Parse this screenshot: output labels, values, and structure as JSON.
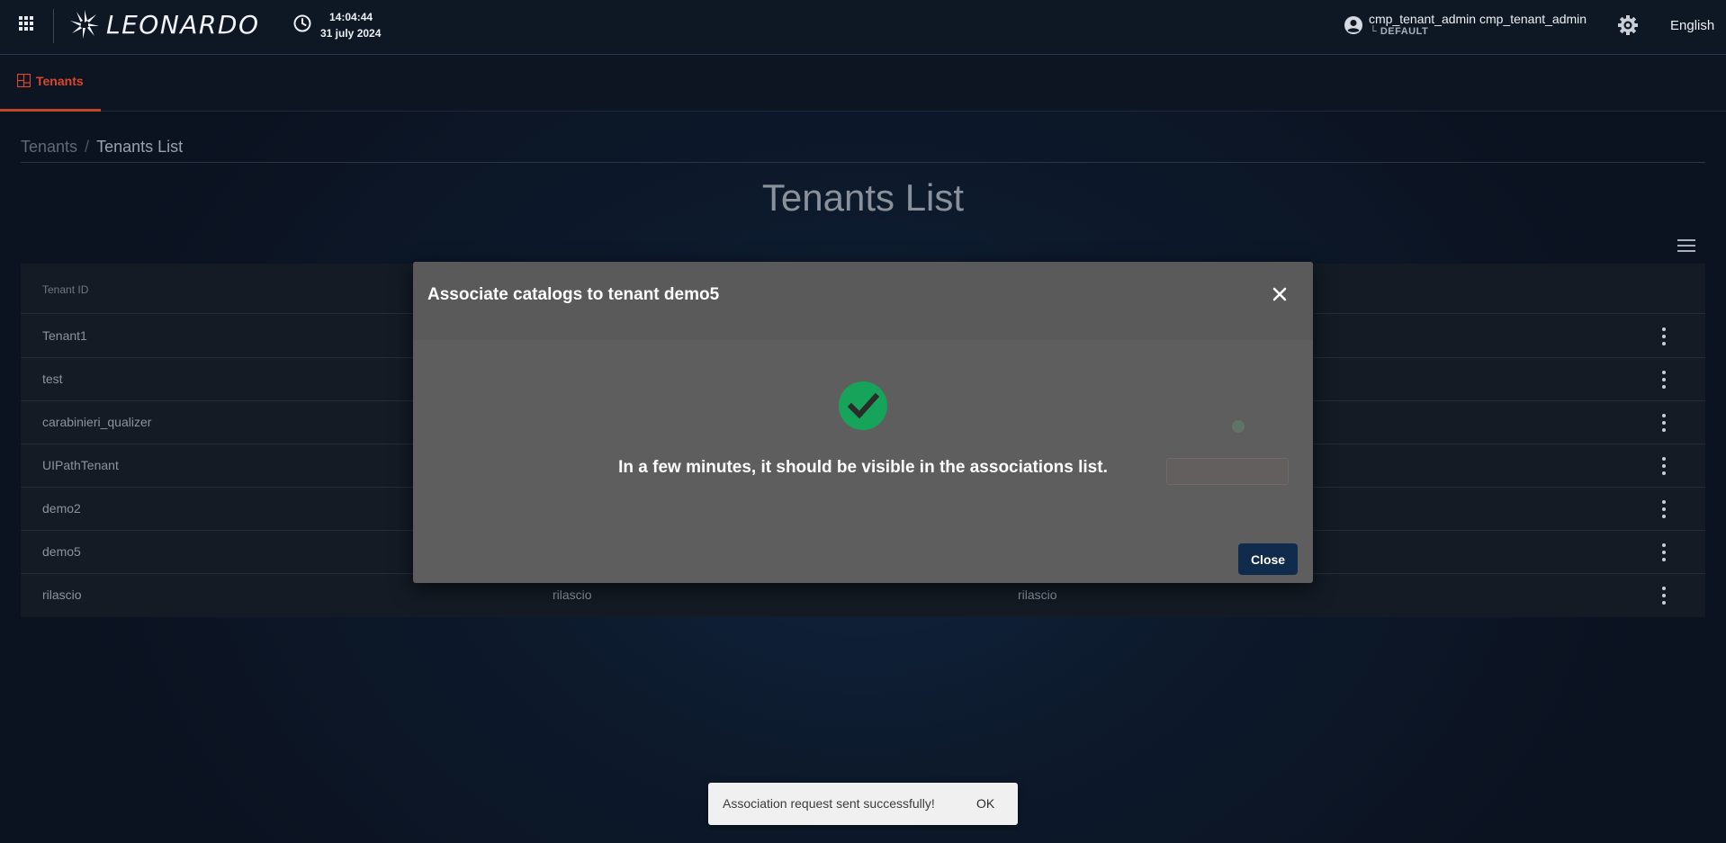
{
  "header": {
    "brand": "LEONARDO",
    "time": "14:04:44",
    "date": "31 july 2024",
    "user_name": "cmp_tenant_admin cmp_tenant_admin",
    "user_tenant": "└ DEFAULT",
    "language": "English"
  },
  "nav": {
    "tabs": [
      {
        "label": "Tenants",
        "active": true
      }
    ],
    "accent_color": "#d9472d"
  },
  "breadcrumb": {
    "root": "Tenants",
    "separator": "/",
    "current": "Tenants List"
  },
  "page": {
    "title": "Tenants List"
  },
  "table": {
    "columns": [
      "Tenant ID"
    ],
    "rows": [
      {
        "id": "Tenant1",
        "col2": "",
        "col3": ""
      },
      {
        "id": "test",
        "col2": "",
        "col3": ""
      },
      {
        "id": "carabinieri_qualizer",
        "col2": "",
        "col3": ""
      },
      {
        "id": "UIPathTenant",
        "col2": "",
        "col3": ""
      },
      {
        "id": "demo2",
        "col2": "",
        "col3": ""
      },
      {
        "id": "demo5",
        "col2": "",
        "col3": ""
      },
      {
        "id": "rilascio",
        "col2": "rilascio",
        "col3": "rilascio"
      }
    ]
  },
  "modal": {
    "title": "Associate catalogs to tenant demo5",
    "message": "In a few minutes, it should be visible in the associations list.",
    "close_label": "Close",
    "success_color": "#16a35a"
  },
  "snackbar": {
    "message": "Association request sent successfully!",
    "action": "OK"
  }
}
